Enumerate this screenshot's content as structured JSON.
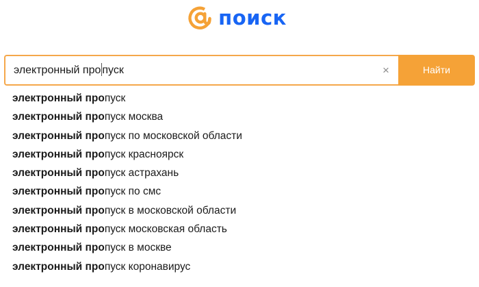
{
  "logo": {
    "icon": "at-sign-icon",
    "text": "поиск",
    "icon_color": "#f5a237",
    "text_color": "#1865f4"
  },
  "search": {
    "value_before_caret": "электронный про",
    "value_after_caret": "пуск",
    "clear_label": "×",
    "button_label": "Найти",
    "accent_color": "#f5a237"
  },
  "suggestions": [
    {
      "bold": "электронный про",
      "rest": "пуск"
    },
    {
      "bold": "электронный про",
      "rest": "пуск москва"
    },
    {
      "bold": "электронный про",
      "rest": "пуск по московской области"
    },
    {
      "bold": "электронный про",
      "rest": "пуск красноярск"
    },
    {
      "bold": "электронный про",
      "rest": "пуск астрахань"
    },
    {
      "bold": "электронный про",
      "rest": "пуск по смс"
    },
    {
      "bold": "электронный про",
      "rest": "пуск в московской области"
    },
    {
      "bold": "электронный про",
      "rest": "пуск московская область"
    },
    {
      "bold": "электронный про",
      "rest": "пуск в москве"
    },
    {
      "bold": "электронный про",
      "rest": "пуск коронавирус"
    }
  ]
}
